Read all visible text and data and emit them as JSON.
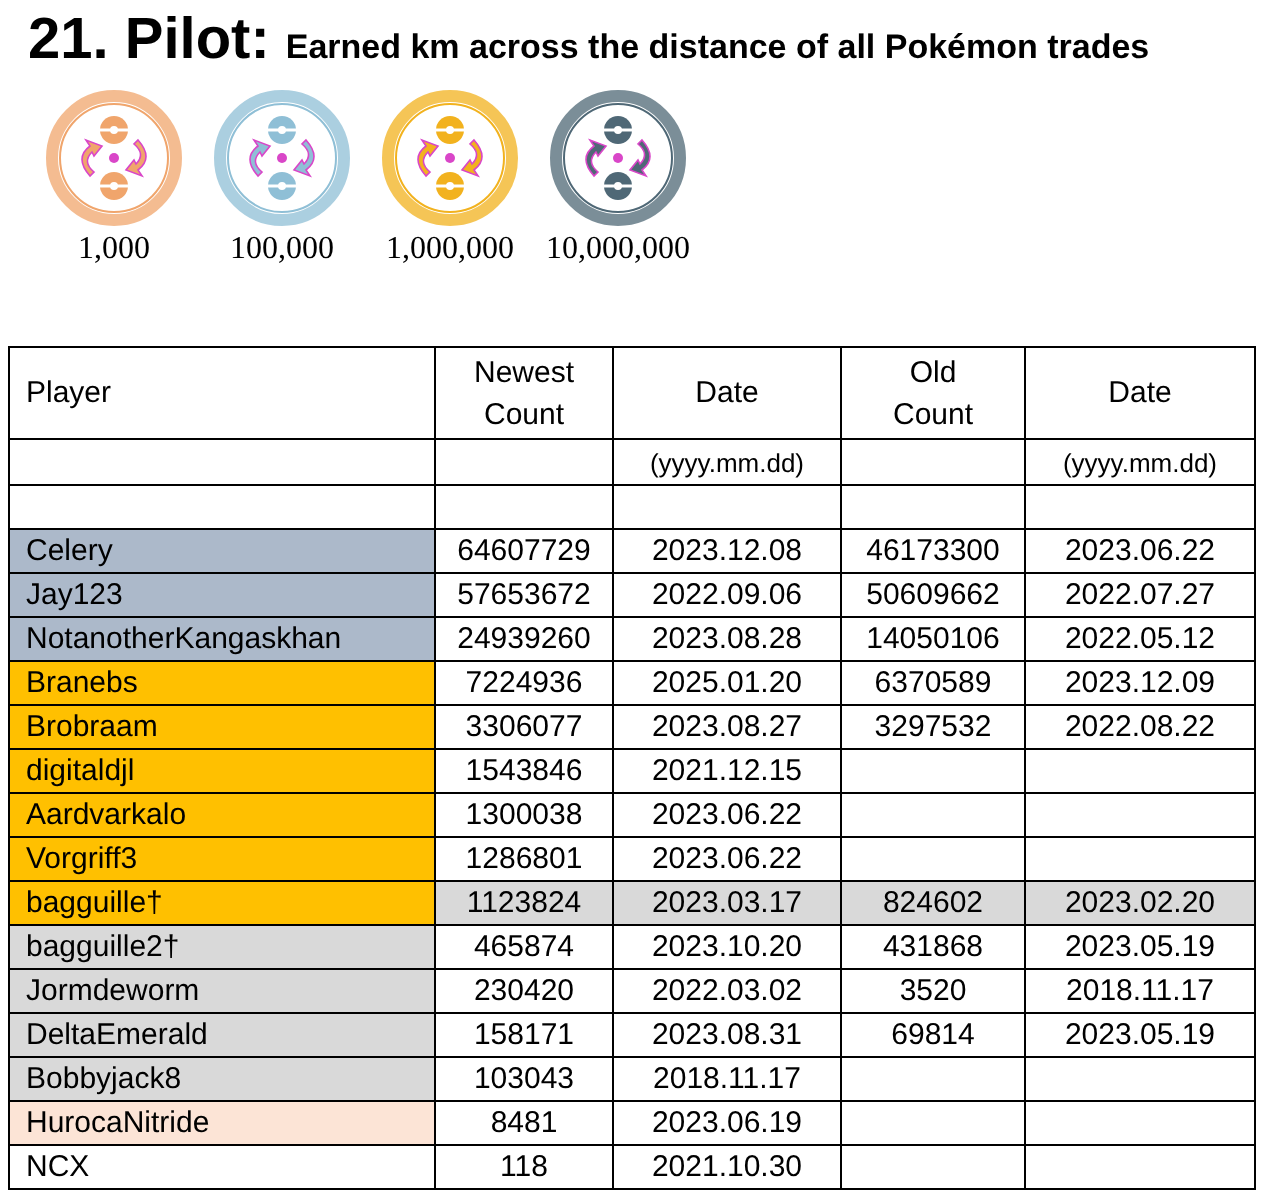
{
  "title": {
    "number": "21. Pilot:",
    "description": "Earned km across the distance of all Pokémon trades"
  },
  "medals": [
    {
      "label": "1,000",
      "color": "#f0a56c"
    },
    {
      "label": "100,000",
      "color": "#8fbfd6"
    },
    {
      "label": "1,000,000",
      "color": "#f2b21e"
    },
    {
      "label": "10,000,000",
      "color": "#4f6876"
    }
  ],
  "table": {
    "columns": [
      {
        "label": "Player"
      },
      {
        "label": "Newest Count"
      },
      {
        "label": "Date",
        "note": "(yyyy.mm.dd)"
      },
      {
        "label": "Old Count"
      },
      {
        "label": "Date",
        "note": "(yyyy.mm.dd)"
      }
    ],
    "rows": [
      {
        "player": "Celery",
        "color": "#acb9ca",
        "highlight": false,
        "newest": "64607729",
        "date": "2023.12.08",
        "old": "46173300",
        "old_date": "2023.06.22"
      },
      {
        "player": "Jay123",
        "color": "#acb9ca",
        "highlight": false,
        "newest": "57653672",
        "date": "2022.09.06",
        "old": "50609662",
        "old_date": "2022.07.27"
      },
      {
        "player": "NotanotherKangaskhan",
        "color": "#acb9ca",
        "highlight": false,
        "newest": "24939260",
        "date": "2023.08.28",
        "old": "14050106",
        "old_date": "2022.05.12"
      },
      {
        "player": "Branebs",
        "color": "#ffc000",
        "highlight": false,
        "newest": "7224936",
        "date": "2025.01.20",
        "old": "6370589",
        "old_date": "2023.12.09"
      },
      {
        "player": "Brobraam",
        "color": "#ffc000",
        "highlight": false,
        "newest": "3306077",
        "date": "2023.08.27",
        "old": "3297532",
        "old_date": "2022.08.22"
      },
      {
        "player": "digitaldjl",
        "color": "#ffc000",
        "highlight": false,
        "newest": "1543846",
        "date": "2021.12.15"
      },
      {
        "player": "Aardvarkalo",
        "color": "#ffc000",
        "highlight": false,
        "newest": "1300038",
        "date": "2023.06.22"
      },
      {
        "player": "Vorgriff3",
        "color": "#ffc000",
        "highlight": false,
        "newest": "1286801",
        "date": "2023.06.22"
      },
      {
        "player": "bagguille†",
        "color": "#ffc000",
        "highlight": true,
        "newest": "1123824",
        "date": "2023.03.17",
        "old": "824602",
        "old_date": "2023.02.20"
      },
      {
        "player": "bagguille2†",
        "color": "#d9d9d9",
        "highlight": false,
        "newest": "465874",
        "date": "2023.10.20",
        "old": "431868",
        "old_date": "2023.05.19"
      },
      {
        "player": "Jormdeworm",
        "color": "#d9d9d9",
        "highlight": false,
        "newest": "230420",
        "date": "2022.03.02",
        "old": "3520",
        "old_date": "2018.11.17"
      },
      {
        "player": "DeltaEmerald",
        "color": "#d9d9d9",
        "highlight": false,
        "newest": "158171",
        "date": "2023.08.31",
        "old": "69814",
        "old_date": "2023.05.19"
      },
      {
        "player": "Bobbyjack8",
        "color": "#d9d9d9",
        "highlight": false,
        "newest": "103043",
        "date": "2018.11.17"
      },
      {
        "player": "HurocaNitride",
        "color": "#fce4d6",
        "highlight": false,
        "newest": "8481",
        "date": "2023.06.19"
      },
      {
        "player": "NCX",
        "color": "#ffffff",
        "highlight": false,
        "newest": "118",
        "date": "2021.10.30"
      }
    ]
  }
}
